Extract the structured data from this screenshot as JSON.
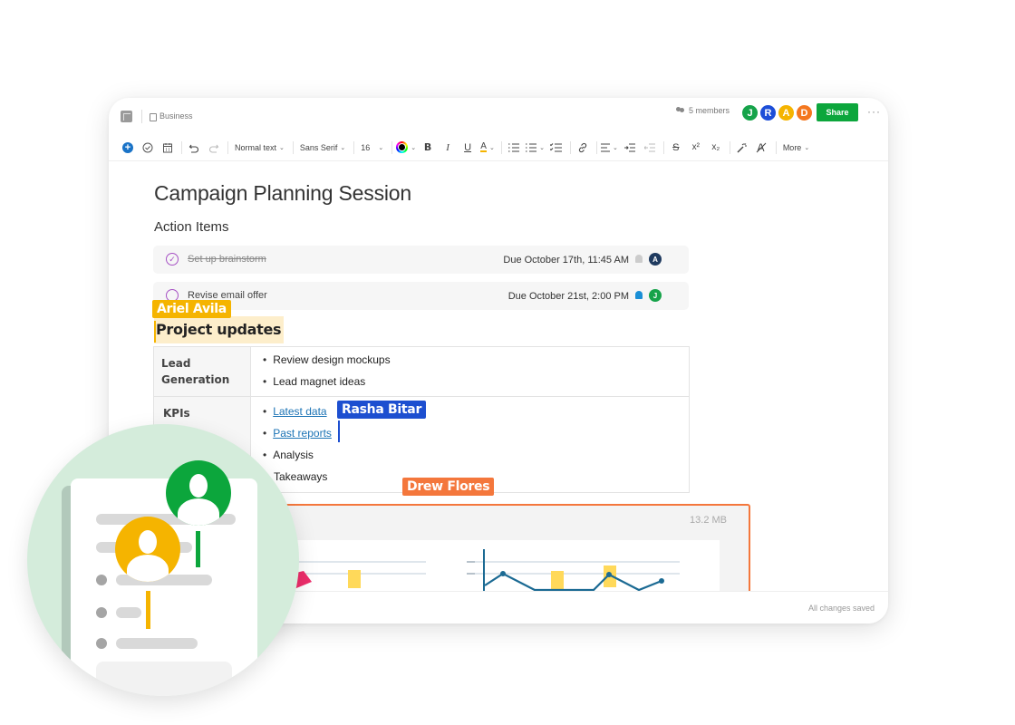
{
  "header": {
    "notebook": "Business",
    "members_label": "5 members",
    "avatars": [
      {
        "initial": "J",
        "color": "#16a34a"
      },
      {
        "initial": "R",
        "color": "#1d4ed8"
      },
      {
        "initial": "A",
        "color": "#f5b400"
      },
      {
        "initial": "D",
        "color": "#f4771f"
      }
    ],
    "share_label": "Share",
    "more_label": "···"
  },
  "toolbar": {
    "add": "+",
    "text_style": "Normal text",
    "font": "Sans Serif",
    "size": "16",
    "bold": "B",
    "italic": "I",
    "underline": "U",
    "highlight": "A",
    "superscript": "x²",
    "subscript": "x₂",
    "more": "More"
  },
  "document": {
    "title": "Campaign Planning Session",
    "action_heading": "Action Items",
    "tasks": [
      {
        "label": "Set up brainstorm",
        "done": true,
        "due": "Due October 17th, 11:45 AM",
        "assignee": "A",
        "assignee_color": "#1f3a5f",
        "bell_color": "#cccccc"
      },
      {
        "label": "Revise email offer",
        "done": false,
        "due": "Due October 21st, 2:00 PM",
        "assignee": "J",
        "assignee_color": "#16a34a",
        "bell_color": "#1a8fd6"
      }
    ],
    "project_heading": "Project updates",
    "table": [
      {
        "head": "Lead Generation",
        "items": [
          "Review design mockups",
          "Lead magnet ideas"
        ]
      },
      {
        "head": "KPIs",
        "items": [
          "Latest data",
          "Past reports",
          "Analysis",
          "Takeaways"
        ]
      }
    ],
    "attachment_size": "13.2 MB"
  },
  "collaborators": [
    {
      "name": "Ariel Avila",
      "color": "#f5b400"
    },
    {
      "name": "Rasha Bitar",
      "color": "#1d4fd0"
    },
    {
      "name": "Drew Flores",
      "color": "#f4773c"
    }
  ],
  "footer": {
    "status": "All changes saved"
  }
}
